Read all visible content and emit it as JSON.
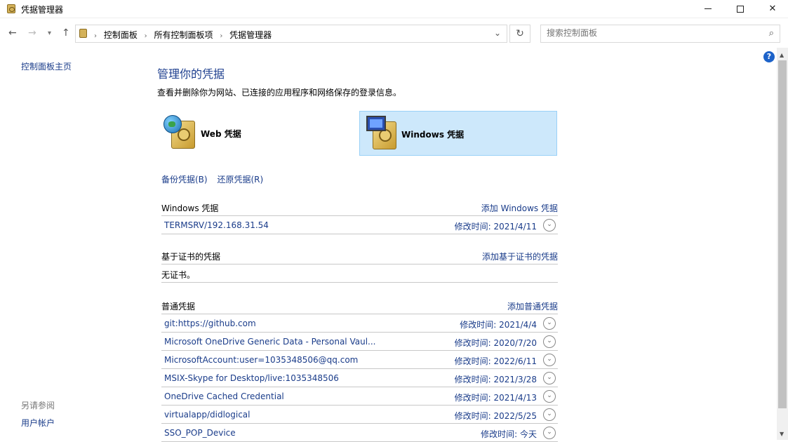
{
  "window": {
    "title": "凭据管理器"
  },
  "address": {
    "crumbs": [
      "控制面板",
      "所有控制面板项",
      "凭据管理器"
    ],
    "search_placeholder": "搜索控制面板"
  },
  "left": {
    "home": "控制面板主页",
    "see_also": "另请参阅",
    "user_accounts": "用户帐户"
  },
  "main": {
    "heading": "管理你的凭据",
    "description": "查看并删除你为网站、已连接的应用程序和网络保存的登录信息。",
    "tiles": {
      "web": "Web 凭据",
      "windows": "Windows 凭据"
    },
    "links": {
      "backup": "备份凭据(B)",
      "restore": "还原凭据(R)"
    }
  },
  "sections": {
    "windows": {
      "title": "Windows 凭据",
      "add": "添加 Windows 凭据",
      "items": [
        {
          "name": "TERMSRV/192.168.31.54",
          "date": "修改时间:  2021/4/11"
        }
      ]
    },
    "cert": {
      "title": "基于证书的凭据",
      "add": "添加基于证书的凭据",
      "empty": "无证书。"
    },
    "generic": {
      "title": "普通凭据",
      "add": "添加普通凭据",
      "items": [
        {
          "name": "git:https://github.com",
          "date": "修改时间:  2021/4/4"
        },
        {
          "name": "Microsoft OneDrive Generic Data - Personal Vaul...",
          "date": "修改时间:  2020/7/20"
        },
        {
          "name": "MicrosoftAccount:user=1035348506@qq.com",
          "date": "修改时间:  2022/6/11"
        },
        {
          "name": "MSIX-Skype for Desktop/live:1035348506",
          "date": "修改时间:  2021/3/28"
        },
        {
          "name": "OneDrive Cached Credential",
          "date": "修改时间:  2021/4/13"
        },
        {
          "name": "virtualapp/didlogical",
          "date": "修改时间:  2022/5/25"
        },
        {
          "name": "SSO_POP_Device",
          "date": "修改时间:  今天"
        }
      ]
    }
  },
  "colors": {
    "link": "#1a3c8a",
    "heading": "#1e3f8f",
    "selected_tile": "#cde8fb"
  }
}
